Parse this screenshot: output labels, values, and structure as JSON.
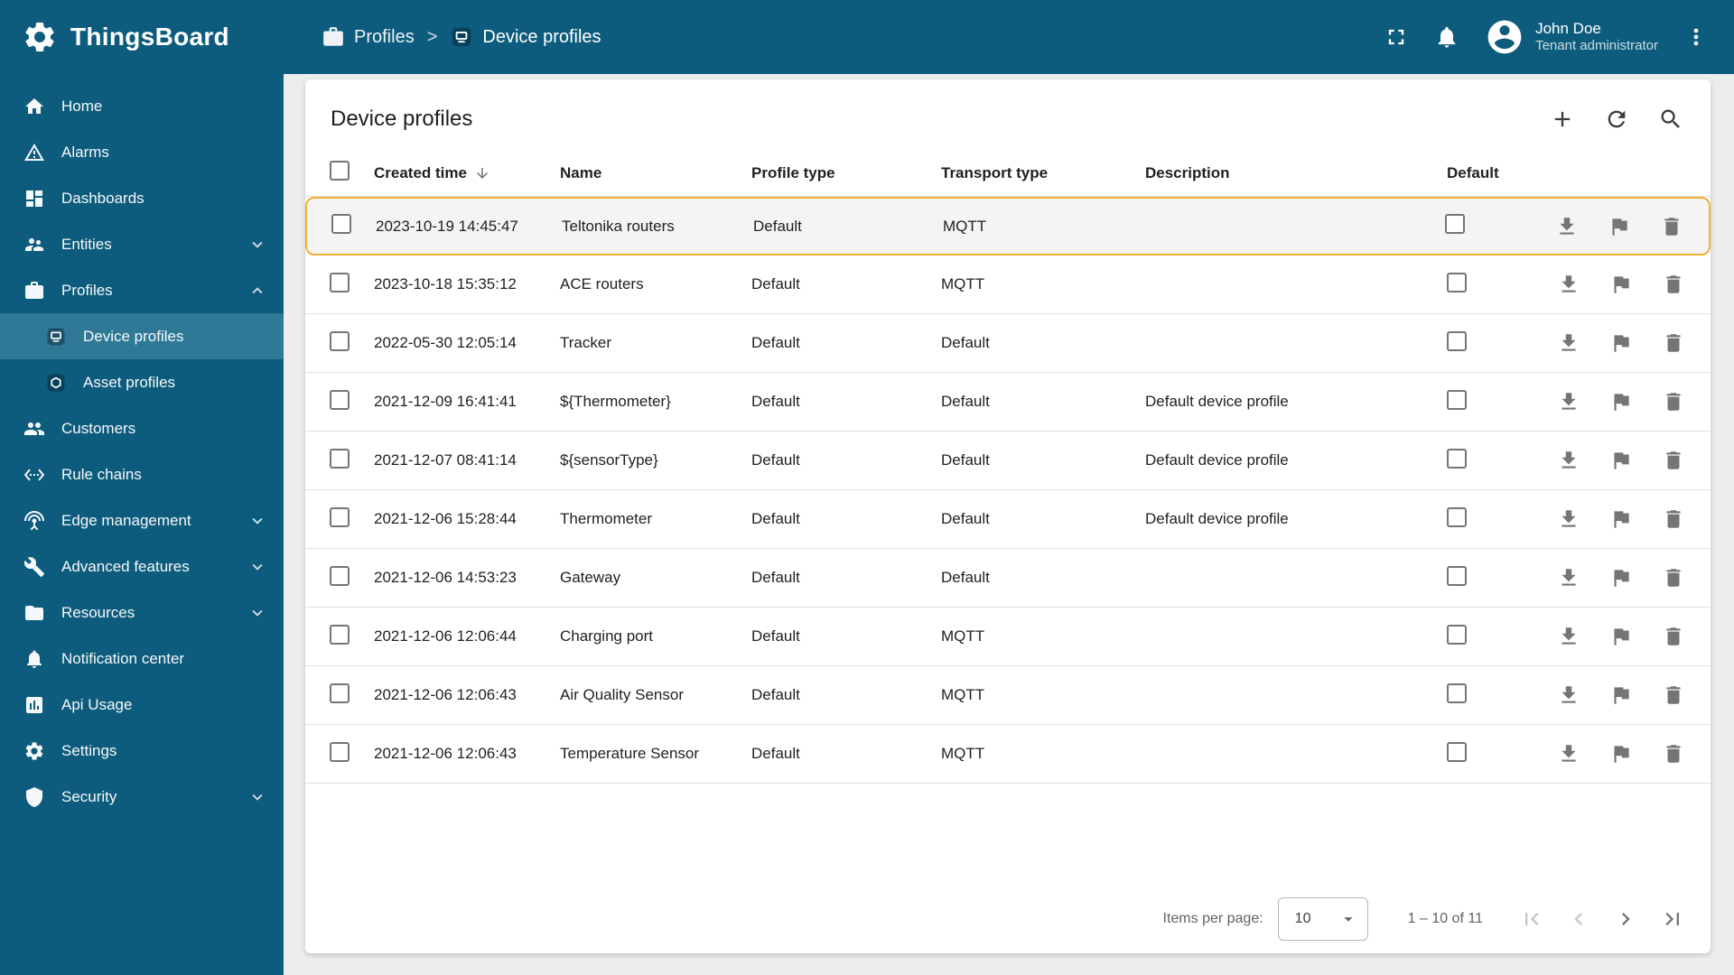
{
  "app": {
    "title": "ThingsBoard"
  },
  "topbar": {
    "separator": ">",
    "breadcrumb": [
      {
        "label": "Profiles",
        "icon": "profiles-icon"
      },
      {
        "label": "Device profiles",
        "icon": "device-profile-icon"
      }
    ],
    "icons": [
      "fullscreen-icon",
      "notifications-icon",
      "account-icon",
      "more-vert-icon"
    ],
    "user": {
      "name": "John Doe",
      "role": "Tenant administrator"
    }
  },
  "sidebar": {
    "items": [
      {
        "label": "Home",
        "icon": "home-icon"
      },
      {
        "label": "Alarms",
        "icon": "alarms-icon"
      },
      {
        "label": "Dashboards",
        "icon": "dashboards-icon"
      },
      {
        "label": "Entities",
        "icon": "entities-icon",
        "expandable": true,
        "expanded": false
      },
      {
        "label": "Profiles",
        "icon": "profiles-icon",
        "expandable": true,
        "expanded": true
      },
      {
        "label": "Device profiles",
        "icon": "device-profile-icon",
        "child": true,
        "selected": true
      },
      {
        "label": "Asset profiles",
        "icon": "asset-profile-icon",
        "child": true
      },
      {
        "label": "Customers",
        "icon": "customers-icon"
      },
      {
        "label": "Rule chains",
        "icon": "rule-chains-icon"
      },
      {
        "label": "Edge management",
        "icon": "edge-management-icon",
        "expandable": true,
        "expanded": false
      },
      {
        "label": "Advanced features",
        "icon": "advanced-features-icon",
        "expandable": true,
        "expanded": false
      },
      {
        "label": "Resources",
        "icon": "resources-icon",
        "expandable": true,
        "expanded": false
      },
      {
        "label": "Notification center",
        "icon": "notification-center-icon"
      },
      {
        "label": "Api Usage",
        "icon": "api-usage-icon"
      },
      {
        "label": "Settings",
        "icon": "settings-icon"
      },
      {
        "label": "Security",
        "icon": "security-icon",
        "expandable": true,
        "expanded": false
      }
    ]
  },
  "main": {
    "title": "Device profiles",
    "toolbar_icons": [
      "add-icon",
      "refresh-icon",
      "search-icon"
    ],
    "table": {
      "columns": [
        "Created time",
        "Name",
        "Profile type",
        "Transport type",
        "Description",
        "Default"
      ],
      "sort_column": "Created time",
      "sort_direction": "desc",
      "row_actions": [
        "download-icon",
        "flag-icon",
        "delete-icon"
      ],
      "rows": [
        {
          "created_time": "2023-10-19 14:45:47",
          "name": "Teltonika routers",
          "profile_type": "Default",
          "transport_type": "MQTT",
          "description": "",
          "default": false,
          "highlighted": true
        },
        {
          "created_time": "2023-10-18 15:35:12",
          "name": "ACE routers",
          "profile_type": "Default",
          "transport_type": "MQTT",
          "description": "",
          "default": false
        },
        {
          "created_time": "2022-05-30 12:05:14",
          "name": "Tracker",
          "profile_type": "Default",
          "transport_type": "Default",
          "description": "",
          "default": false
        },
        {
          "created_time": "2021-12-09 16:41:41",
          "name": "${Thermometer}",
          "profile_type": "Default",
          "transport_type": "Default",
          "description": "Default device profile",
          "default": false
        },
        {
          "created_time": "2021-12-07 08:41:14",
          "name": "${sensorType}",
          "profile_type": "Default",
          "transport_type": "Default",
          "description": "Default device profile",
          "default": false
        },
        {
          "created_time": "2021-12-06 15:28:44",
          "name": "Thermometer",
          "profile_type": "Default",
          "transport_type": "Default",
          "description": "Default device profile",
          "default": false
        },
        {
          "created_time": "2021-12-06 14:53:23",
          "name": "Gateway",
          "profile_type": "Default",
          "transport_type": "Default",
          "description": "",
          "default": false
        },
        {
          "created_time": "2021-12-06 12:06:44",
          "name": "Charging port",
          "profile_type": "Default",
          "transport_type": "MQTT",
          "description": "",
          "default": false
        },
        {
          "created_time": "2021-12-06 12:06:43",
          "name": "Air Quality Sensor",
          "profile_type": "Default",
          "transport_type": "MQTT",
          "description": "",
          "default": false
        },
        {
          "created_time": "2021-12-06 12:06:43",
          "name": "Temperature Sensor",
          "profile_type": "Default",
          "transport_type": "MQTT",
          "description": "",
          "default": false
        }
      ]
    },
    "pagination": {
      "items_per_page_label": "Items per page:",
      "items_per_page_value": "10",
      "range_label": "1 – 10 of 11",
      "icons": [
        "first-page-icon",
        "chevron-left-icon",
        "chevron-right-icon",
        "last-page-icon"
      ]
    }
  },
  "colors": {
    "primary": "#0d5c7d",
    "sidebar_selected": "#2f7896",
    "highlight_border": "#f3b234",
    "content_background": "#ebedef"
  }
}
